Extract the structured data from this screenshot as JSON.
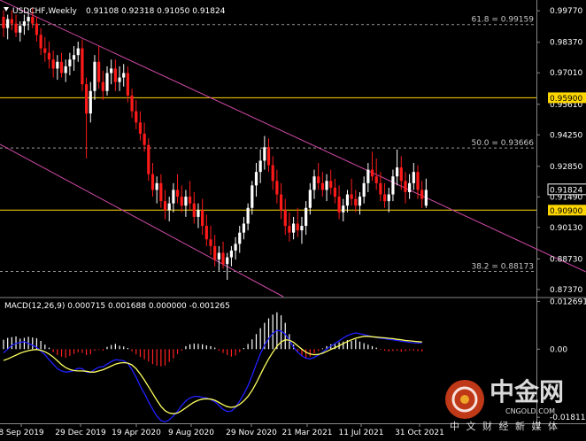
{
  "chart_data": {
    "type": "candlestick",
    "symbol": "USDCHF,Weekly",
    "ohlc_header": "0.91108 0.92318 0.91050 0.91824",
    "last_price": "0.91824",
    "price_ticks": [
      "0.99770",
      "0.98370",
      "0.97010",
      "0.95610",
      "0.94250",
      "0.92850",
      "0.91490",
      "0.90130",
      "0.88730",
      "0.87370"
    ],
    "ylim": [
      0.8705,
      1.0025
    ],
    "fib_levels": [
      {
        "label": "61.8 = 0.99159",
        "value": 0.99159,
        "style": "dashed"
      },
      {
        "label": "50.0 = 0.93666",
        "value": 0.93666,
        "style": "dashed"
      },
      {
        "label": "38.2 = 0.88173",
        "value": 0.88173,
        "style": "dashed"
      }
    ],
    "horizontal_levels": [
      {
        "label": "0.95900",
        "value": 0.959,
        "color": "#ffd700"
      },
      {
        "label": "0.90900",
        "value": 0.909,
        "color": "#ffd700"
      }
    ],
    "trend_channel": {
      "color": "#d04aa8",
      "upper": [
        [
          0,
          1.0025
        ],
        [
          110,
          0.978
        ],
        [
          330,
          0.933
        ],
        [
          662,
          0.8815
        ]
      ],
      "lower": [
        [
          0,
          0.9383
        ],
        [
          320,
          0.8705
        ]
      ]
    },
    "x_labels": [
      "8 Sep 2019",
      "29 Dec 2019",
      "19 Apr 2020",
      "9 Aug 2020",
      "29 Nov 2020",
      "21 Mar 2021",
      "11 Jul 2021",
      "31 Oct 2021"
    ],
    "candles": [
      [
        0.995,
        0.998,
        0.986,
        0.99
      ],
      [
        0.99,
        0.996,
        0.985,
        0.994
      ],
      [
        0.994,
        0.998,
        0.989,
        0.992
      ],
      [
        0.992,
        0.996,
        0.986,
        0.988
      ],
      [
        0.988,
        0.993,
        0.984,
        0.991
      ],
      [
        0.991,
        0.996,
        0.987,
        0.993
      ],
      [
        0.993,
        0.997,
        0.989,
        0.995
      ],
      [
        0.995,
        0.999,
        0.99,
        0.992
      ],
      [
        0.992,
        0.995,
        0.984,
        0.987
      ],
      [
        0.987,
        0.99,
        0.978,
        0.981
      ],
      [
        0.981,
        0.986,
        0.975,
        0.979
      ],
      [
        0.979,
        0.984,
        0.972,
        0.976
      ],
      [
        0.976,
        0.98,
        0.968,
        0.972
      ],
      [
        0.972,
        0.978,
        0.967,
        0.975
      ],
      [
        0.975,
        0.979,
        0.968,
        0.97
      ],
      [
        0.97,
        0.976,
        0.966,
        0.973
      ],
      [
        0.973,
        0.979,
        0.969,
        0.976
      ],
      [
        0.976,
        0.982,
        0.971,
        0.978
      ],
      [
        0.978,
        0.984,
        0.975,
        0.981
      ],
      [
        0.981,
        0.985,
        0.962,
        0.965
      ],
      [
        0.965,
        0.968,
        0.932,
        0.952
      ],
      [
        0.952,
        0.966,
        0.948,
        0.962
      ],
      [
        0.962,
        0.978,
        0.958,
        0.975
      ],
      [
        0.975,
        0.982,
        0.963,
        0.966
      ],
      [
        0.966,
        0.971,
        0.958,
        0.962
      ],
      [
        0.962,
        0.973,
        0.96,
        0.97
      ],
      [
        0.97,
        0.976,
        0.965,
        0.972
      ],
      [
        0.972,
        0.976,
        0.962,
        0.966
      ],
      [
        0.966,
        0.973,
        0.962,
        0.968
      ],
      [
        0.968,
        0.974,
        0.964,
        0.97
      ],
      [
        0.97,
        0.973,
        0.957,
        0.96
      ],
      [
        0.96,
        0.963,
        0.95,
        0.953
      ],
      [
        0.953,
        0.958,
        0.945,
        0.948
      ],
      [
        0.948,
        0.953,
        0.94,
        0.943
      ],
      [
        0.943,
        0.948,
        0.935,
        0.938
      ],
      [
        0.938,
        0.941,
        0.922,
        0.925
      ],
      [
        0.925,
        0.93,
        0.915,
        0.918
      ],
      [
        0.918,
        0.924,
        0.912,
        0.921
      ],
      [
        0.921,
        0.925,
        0.91,
        0.913
      ],
      [
        0.913,
        0.918,
        0.905,
        0.909
      ],
      [
        0.909,
        0.915,
        0.904,
        0.912
      ],
      [
        0.912,
        0.921,
        0.908,
        0.918
      ],
      [
        0.918,
        0.925,
        0.912,
        0.915
      ],
      [
        0.915,
        0.92,
        0.908,
        0.911
      ],
      [
        0.911,
        0.918,
        0.906,
        0.915
      ],
      [
        0.915,
        0.922,
        0.909,
        0.912
      ],
      [
        0.912,
        0.917,
        0.903,
        0.906
      ],
      [
        0.906,
        0.912,
        0.901,
        0.909
      ],
      [
        0.909,
        0.914,
        0.898,
        0.902
      ],
      [
        0.902,
        0.907,
        0.893,
        0.896
      ],
      [
        0.896,
        0.902,
        0.889,
        0.893
      ],
      [
        0.893,
        0.898,
        0.884,
        0.887
      ],
      [
        0.887,
        0.893,
        0.882,
        0.89
      ],
      [
        0.89,
        0.895,
        0.883,
        0.885
      ],
      [
        0.885,
        0.89,
        0.878,
        0.888
      ],
      [
        0.888,
        0.893,
        0.884,
        0.891
      ],
      [
        0.891,
        0.897,
        0.887,
        0.894
      ],
      [
        0.894,
        0.902,
        0.89,
        0.899
      ],
      [
        0.899,
        0.906,
        0.896,
        0.903
      ],
      [
        0.903,
        0.912,
        0.9,
        0.91
      ],
      [
        0.91,
        0.922,
        0.907,
        0.92
      ],
      [
        0.92,
        0.93,
        0.915,
        0.926
      ],
      [
        0.926,
        0.936,
        0.921,
        0.931
      ],
      [
        0.931,
        0.942,
        0.927,
        0.937
      ],
      [
        0.937,
        0.941,
        0.926,
        0.929
      ],
      [
        0.929,
        0.933,
        0.918,
        0.922
      ],
      [
        0.922,
        0.927,
        0.912,
        0.916
      ],
      [
        0.916,
        0.921,
        0.905,
        0.909
      ],
      [
        0.909,
        0.914,
        0.898,
        0.902
      ],
      [
        0.902,
        0.908,
        0.895,
        0.899
      ],
      [
        0.899,
        0.906,
        0.896,
        0.903
      ],
      [
        0.903,
        0.91,
        0.897,
        0.9
      ],
      [
        0.9,
        0.906,
        0.894,
        0.902
      ],
      [
        0.902,
        0.913,
        0.898,
        0.91
      ],
      [
        0.91,
        0.921,
        0.907,
        0.918
      ],
      [
        0.918,
        0.927,
        0.914,
        0.924
      ],
      [
        0.924,
        0.93,
        0.918,
        0.921
      ],
      [
        0.921,
        0.926,
        0.915,
        0.918
      ],
      [
        0.918,
        0.925,
        0.913,
        0.922
      ],
      [
        0.922,
        0.927,
        0.916,
        0.919
      ],
      [
        0.919,
        0.923,
        0.912,
        0.915
      ],
      [
        0.915,
        0.92,
        0.905,
        0.908
      ],
      [
        0.908,
        0.914,
        0.904,
        0.911
      ],
      [
        0.911,
        0.918,
        0.908,
        0.916
      ],
      [
        0.916,
        0.923,
        0.911,
        0.914
      ],
      [
        0.914,
        0.918,
        0.908,
        0.911
      ],
      [
        0.911,
        0.917,
        0.907,
        0.915
      ],
      [
        0.915,
        0.924,
        0.912,
        0.921
      ],
      [
        0.921,
        0.93,
        0.917,
        0.927
      ],
      [
        0.927,
        0.935,
        0.922,
        0.924
      ],
      [
        0.924,
        0.932,
        0.918,
        0.921
      ],
      [
        0.921,
        0.926,
        0.913,
        0.916
      ],
      [
        0.916,
        0.921,
        0.91,
        0.913
      ],
      [
        0.913,
        0.919,
        0.908,
        0.916
      ],
      [
        0.916,
        0.927,
        0.913,
        0.924
      ],
      [
        0.924,
        0.936,
        0.92,
        0.928
      ],
      [
        0.928,
        0.933,
        0.918,
        0.922
      ],
      [
        0.922,
        0.926,
        0.912,
        0.917
      ],
      [
        0.917,
        0.925,
        0.914,
        0.921
      ],
      [
        0.921,
        0.93,
        0.918,
        0.926
      ],
      [
        0.926,
        0.929,
        0.914,
        0.918
      ],
      [
        0.918,
        0.922,
        0.91,
        0.914
      ],
      [
        0.911,
        0.923,
        0.91,
        0.918
      ]
    ],
    "macd": {
      "label": "MACD(12,26,9) 0.000715 0.001688 0.000000 -0.001265",
      "ticks": [
        "0.012691",
        "0.00",
        "-0.018118"
      ],
      "ylim": [
        -0.0195,
        0.0135
      ],
      "histogram_up_color": "#ffffff",
      "histogram_down_color": "#ff2020",
      "main_color": "#2020ff",
      "signal_color": "#ffff60",
      "histogram": [
        0.0025,
        0.003,
        0.0032,
        0.0034,
        0.0028,
        0.003,
        0.0033,
        0.0031,
        0.0029,
        0.0022,
        0.0012,
        0.0004,
        -0.0008,
        -0.0016,
        -0.002,
        -0.0023,
        -0.0018,
        -0.0013,
        -0.0008,
        -0.001,
        -0.0016,
        -0.0014,
        -0.0004,
        -0.0002,
        -0.0004,
        0.0006,
        0.0011,
        0.0014,
        0.0009,
        0.0007,
        0.0003,
        -0.0006,
        -0.0014,
        -0.0021,
        -0.0027,
        -0.0033,
        -0.004,
        -0.0044,
        -0.0046,
        -0.0044,
        -0.0034,
        -0.0025,
        -0.0013,
        -0.0004,
        0.0008,
        0.0013,
        0.0015,
        0.0014,
        0.0013,
        0.001,
        0.0008,
        0.0004,
        -0.0004,
        -0.001,
        -0.0016,
        -0.002,
        -0.0017,
        -0.0008,
        0.0003,
        0.0014,
        0.0026,
        0.004,
        0.0056,
        0.007,
        0.0082,
        0.0092,
        0.0098,
        0.009,
        0.007,
        0.004,
        0.0012,
        -0.0006,
        -0.0018,
        -0.0024,
        -0.002,
        -0.0012,
        -0.0005,
        0.0002,
        0.0008,
        0.0013,
        0.0016,
        0.0018,
        0.002,
        0.0024,
        0.0022,
        0.0026,
        0.002,
        0.0016,
        0.0012,
        0.0008,
        0.0004,
        -0.0002,
        -0.0004,
        -0.0006,
        -0.0005,
        -0.0004,
        -0.0007,
        -0.0005,
        -0.0003,
        -0.0004,
        -0.0005,
        -0.0006
      ],
      "main": [
        -0.001,
        0.0,
        0.001,
        0.0015,
        0.0018,
        0.002,
        0.0015,
        0.001,
        0.0005,
        -0.0005,
        -0.0015,
        -0.0028,
        -0.004,
        -0.0052,
        -0.0058,
        -0.0061,
        -0.006,
        -0.0057,
        -0.0051,
        -0.0052,
        -0.0061,
        -0.0062,
        -0.0054,
        -0.0048,
        -0.0047,
        -0.004,
        -0.0033,
        -0.0028,
        -0.0029,
        -0.0031,
        -0.0038,
        -0.0055,
        -0.0075,
        -0.0098,
        -0.0118,
        -0.014,
        -0.016,
        -0.0178,
        -0.019,
        -0.0194,
        -0.0188,
        -0.0178,
        -0.0165,
        -0.015,
        -0.0138,
        -0.013,
        -0.0126,
        -0.0126,
        -0.0128,
        -0.013,
        -0.0134,
        -0.014,
        -0.015,
        -0.016,
        -0.0166,
        -0.0165,
        -0.0155,
        -0.0138,
        -0.012,
        -0.0098,
        -0.007,
        -0.004,
        -0.0012,
        0.001,
        0.0028,
        0.0042,
        0.005,
        0.0048,
        0.004,
        0.0024,
        0.0005,
        -0.0008,
        -0.0018,
        -0.0024,
        -0.0026,
        -0.0022,
        -0.0016,
        -0.0008,
        0.0,
        0.0008,
        0.0015,
        0.0022,
        0.003,
        0.0036,
        0.004,
        0.0043,
        0.0041,
        0.0039,
        0.0036,
        0.0033,
        0.0031,
        0.0029,
        0.0028,
        0.0026,
        0.0025,
        0.0023,
        0.0021,
        0.002,
        0.0018,
        0.0017,
        0.0016,
        0.0017
      ],
      "signal": [
        -0.003,
        -0.0026,
        -0.0021,
        -0.0016,
        -0.0011,
        -0.0007,
        -0.0004,
        -0.0002,
        -0.0001,
        -0.0003,
        -0.0007,
        -0.0013,
        -0.0021,
        -0.0031,
        -0.0041,
        -0.0049,
        -0.0054,
        -0.0057,
        -0.0058,
        -0.0058,
        -0.0059,
        -0.0061,
        -0.0061,
        -0.0058,
        -0.0055,
        -0.005,
        -0.0045,
        -0.004,
        -0.0037,
        -0.0036,
        -0.0037,
        -0.0042,
        -0.0052,
        -0.0066,
        -0.0082,
        -0.01,
        -0.0118,
        -0.0136,
        -0.0152,
        -0.0164,
        -0.017,
        -0.0172,
        -0.017,
        -0.0164,
        -0.0156,
        -0.0148,
        -0.0141,
        -0.0136,
        -0.0133,
        -0.0132,
        -0.0133,
        -0.0136,
        -0.0142,
        -0.0148,
        -0.0153,
        -0.0155,
        -0.0153,
        -0.0147,
        -0.0138,
        -0.0126,
        -0.011,
        -0.009,
        -0.0068,
        -0.0046,
        -0.0026,
        -0.0008,
        0.0008,
        0.0019,
        0.0025,
        0.0024,
        0.0018,
        0.0009,
        0.0,
        -0.0008,
        -0.0013,
        -0.0015,
        -0.0014,
        -0.0011,
        -0.0006,
        -0.0001,
        0.0004,
        0.0009,
        0.0015,
        0.002,
        0.0025,
        0.0029,
        0.0032,
        0.0034,
        0.0034,
        0.0033,
        0.0032,
        0.0031,
        0.003,
        0.0029,
        0.0028,
        0.0026,
        0.0025,
        0.0023,
        0.0022,
        0.0021,
        0.002,
        0.0019
      ]
    }
  },
  "watermark": {
    "cn": "中金网",
    "en": "CNGOLD.COM",
    "sub": "中 文 财 经 新 媒 体",
    "logo_color": "#e0421b"
  }
}
